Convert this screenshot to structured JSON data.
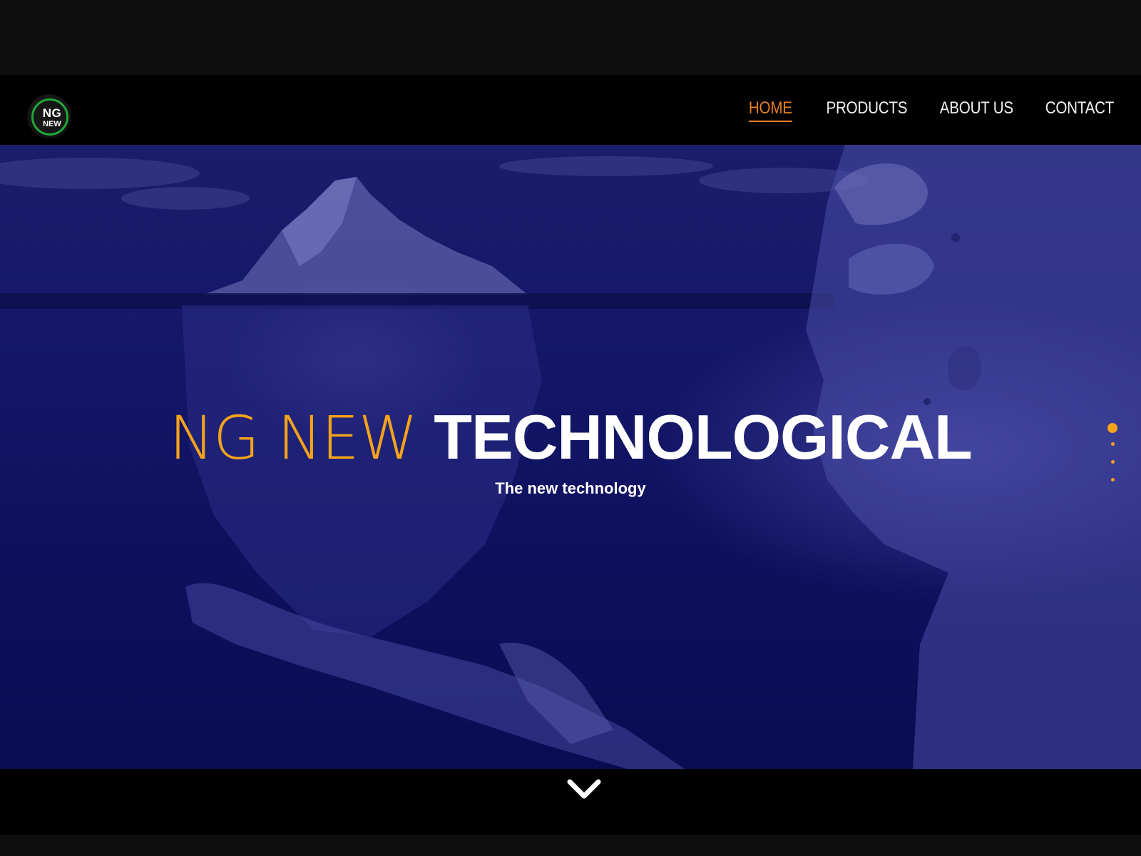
{
  "header": {
    "logo": {
      "line1": "NG",
      "line2": "NEW"
    },
    "nav": [
      {
        "label": "HOME",
        "active": true
      },
      {
        "label": "PRODUCTS",
        "active": false
      },
      {
        "label": "ABOUT US",
        "active": false
      },
      {
        "label": "CONTACT",
        "active": false
      }
    ]
  },
  "hero": {
    "title_accent": "NG NEW",
    "title_bold": "TECHNOLOGICAL",
    "subtitle": "The new technology",
    "slides": {
      "count": 4,
      "active_index": 0
    },
    "background_icons": [
      "iceberg-image",
      "robot-head-image",
      "robot-arm-image"
    ]
  },
  "colors": {
    "accent_orange": "#f5a31a",
    "nav_active": "#e57f22",
    "hero_blue": "#15186a",
    "logo_ring_green": "#1fa83a"
  },
  "icons": {
    "scroll_down": "chevron-down-icon"
  }
}
